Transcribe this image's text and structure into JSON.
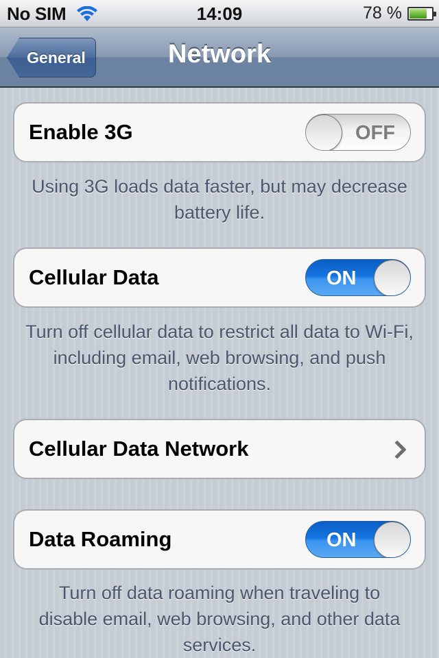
{
  "status_bar": {
    "carrier": "No SIM",
    "wifi_icon": "wifi-icon",
    "time": "14:09",
    "battery_percent_label": "78 %",
    "battery_level": 0.78,
    "battery_color": "#4cb31f"
  },
  "nav_bar": {
    "back_label": "General",
    "title": "Network"
  },
  "settings": {
    "enable_3g": {
      "label": "Enable 3G",
      "state": "OFF",
      "footer": "Using 3G loads data faster, but may decrease battery life."
    },
    "cellular_data": {
      "label": "Cellular Data",
      "state": "ON",
      "footer": "Turn off cellular data to restrict all data to Wi-Fi, including email, web browsing, and push notifications."
    },
    "cellular_data_network": {
      "label": "Cellular Data Network",
      "icon": "chevron-right-icon"
    },
    "data_roaming": {
      "label": "Data Roaming",
      "state": "ON",
      "footer": "Turn off data roaming when traveling to disable email, web browsing, and other data services."
    }
  },
  "colors": {
    "switch_on": "#1574e0",
    "nav_bar": "#6d83a2",
    "footer_text": "#4c566c"
  }
}
